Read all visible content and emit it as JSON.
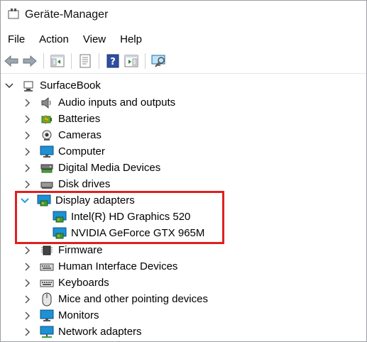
{
  "app_title": "Geräte-Manager",
  "menu": [
    "File",
    "Action",
    "View",
    "Help"
  ],
  "tree": {
    "root": "SurfaceBook",
    "items": [
      {
        "label": "Audio inputs and outputs"
      },
      {
        "label": "Batteries"
      },
      {
        "label": "Cameras"
      },
      {
        "label": "Computer"
      },
      {
        "label": "Digital Media Devices"
      },
      {
        "label": "Disk drives"
      },
      {
        "label": "Display adapters",
        "expanded": true,
        "children": [
          "Intel(R) HD Graphics 520",
          "NVIDIA GeForce GTX 965M"
        ]
      },
      {
        "label": "Firmware"
      },
      {
        "label": "Human Interface Devices"
      },
      {
        "label": "Keyboards"
      },
      {
        "label": "Mice and other pointing devices"
      },
      {
        "label": "Monitors"
      },
      {
        "label": "Network adapters"
      }
    ]
  },
  "colors": {
    "highlight": "#e0201d",
    "chevron_expanded": "#1ba1e2",
    "monitor_blue": "#1e90d6"
  }
}
